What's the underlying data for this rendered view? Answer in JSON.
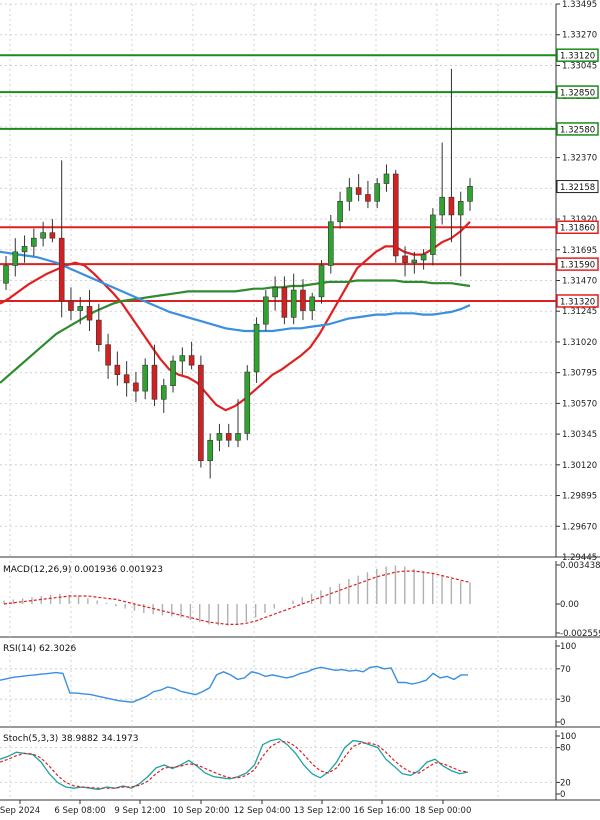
{
  "chart_data": [
    {
      "panel": "price",
      "type": "candlestick",
      "y_ticks": [
        "1.33495",
        "1.33270",
        "1.33045",
        "1.32820",
        "1.32595",
        "1.32370",
        "1.32145",
        "1.31920",
        "1.31695",
        "1.31470",
        "1.31245",
        "1.31020",
        "1.30795",
        "1.30570",
        "1.30345",
        "1.30120",
        "1.29895",
        "1.29670",
        "1.29445"
      ],
      "ylim": [
        1.29445,
        1.33495
      ],
      "current_price": "1.32158",
      "support_resistance": [
        {
          "label": "1.33120",
          "value": 1.3312,
          "color": "#1a8c1a"
        },
        {
          "label": "1.32850",
          "value": 1.3285,
          "color": "#1a8c1a"
        },
        {
          "label": "1.32580",
          "value": 1.3258,
          "color": "#1a8c1a"
        },
        {
          "label": "1.31860",
          "value": 1.3186,
          "color": "#e02020"
        },
        {
          "label": "1.31590",
          "value": 1.3159,
          "color": "#e02020"
        },
        {
          "label": "1.31320",
          "value": 1.3132,
          "color": "#e02020"
        }
      ],
      "candles": [
        [
          1.3145,
          1.3165,
          1.314,
          1.3158
        ],
        [
          1.3158,
          1.3178,
          1.315,
          1.3168
        ],
        [
          1.3168,
          1.318,
          1.316,
          1.3172
        ],
        [
          1.3172,
          1.3185,
          1.3165,
          1.3178
        ],
        [
          1.3178,
          1.319,
          1.3172,
          1.3182
        ],
        [
          1.3182,
          1.3192,
          1.3175,
          1.3178
        ],
        [
          1.3178,
          1.3235,
          1.312,
          1.3132
        ],
        [
          1.3132,
          1.3142,
          1.3118,
          1.3125
        ],
        [
          1.3125,
          1.3135,
          1.3115,
          1.3128
        ],
        [
          1.3128,
          1.314,
          1.311,
          1.3118
        ],
        [
          1.3118,
          1.313,
          1.3095,
          1.31
        ],
        [
          1.31,
          1.3108,
          1.3075,
          1.3085
        ],
        [
          1.3085,
          1.3095,
          1.307,
          1.3078
        ],
        [
          1.3078,
          1.3088,
          1.3062,
          1.3072
        ],
        [
          1.3072,
          1.308,
          1.3058,
          1.3066
        ],
        [
          1.3066,
          1.309,
          1.306,
          1.3085
        ],
        [
          1.3085,
          1.31,
          1.3055,
          1.306
        ],
        [
          1.306,
          1.3075,
          1.305,
          1.307
        ],
        [
          1.307,
          1.3092,
          1.3065,
          1.3088
        ],
        [
          1.3088,
          1.3098,
          1.3078,
          1.3092
        ],
        [
          1.3092,
          1.3102,
          1.3082,
          1.3085
        ],
        [
          1.3085,
          1.3092,
          1.301,
          1.3015
        ],
        [
          1.3015,
          1.3035,
          1.3002,
          1.303
        ],
        [
          1.303,
          1.3042,
          1.3022,
          1.3035
        ],
        [
          1.3035,
          1.3042,
          1.3025,
          1.303
        ],
        [
          1.303,
          1.306,
          1.3025,
          1.3035
        ],
        [
          1.3035,
          1.3085,
          1.303,
          1.308
        ],
        [
          1.308,
          1.312,
          1.3072,
          1.3115
        ],
        [
          1.3115,
          1.314,
          1.311,
          1.3135
        ],
        [
          1.3135,
          1.315,
          1.3125,
          1.3142
        ],
        [
          1.3142,
          1.315,
          1.3115,
          1.312
        ],
        [
          1.312,
          1.3152,
          1.3115,
          1.314
        ],
        [
          1.314,
          1.3148,
          1.3118,
          1.3125
        ],
        [
          1.3125,
          1.3138,
          1.3118,
          1.3135
        ],
        [
          1.3135,
          1.3162,
          1.313,
          1.3158
        ],
        [
          1.3158,
          1.3195,
          1.3152,
          1.319
        ],
        [
          1.319,
          1.3212,
          1.3185,
          1.3205
        ],
        [
          1.3205,
          1.3222,
          1.3198,
          1.3215
        ],
        [
          1.3215,
          1.3225,
          1.3205,
          1.321
        ],
        [
          1.321,
          1.322,
          1.32,
          1.3205
        ],
        [
          1.3205,
          1.3222,
          1.32,
          1.3218
        ],
        [
          1.3218,
          1.3232,
          1.3212,
          1.3225
        ],
        [
          1.3225,
          1.3228,
          1.316,
          1.3165
        ],
        [
          1.3165,
          1.3172,
          1.315,
          1.316
        ],
        [
          1.316,
          1.3168,
          1.3152,
          1.3162
        ],
        [
          1.3162,
          1.317,
          1.3155,
          1.3166
        ],
        [
          1.3166,
          1.32,
          1.3158,
          1.3195
        ],
        [
          1.3195,
          1.3248,
          1.3188,
          1.3208
        ],
        [
          1.3208,
          1.3302,
          1.3175,
          1.3195
        ],
        [
          1.3195,
          1.3212,
          1.315,
          1.3205
        ],
        [
          1.3205,
          1.3222,
          1.3198,
          1.3216
        ]
      ],
      "moving_averages": [
        {
          "color": "#e02020",
          "values": [
            1.313,
            1.3134,
            1.3139,
            1.3144,
            1.3148,
            1.3152,
            1.3155,
            1.3158,
            1.316,
            1.3158,
            1.3152,
            1.3145,
            1.3138,
            1.313,
            1.312,
            1.311,
            1.31,
            1.309,
            1.3082,
            1.3078,
            1.3076,
            1.3072,
            1.3064,
            1.3056,
            1.3052,
            1.3055,
            1.306,
            1.3066,
            1.3072,
            1.3078,
            1.3082,
            1.3087,
            1.3092,
            1.3098,
            1.3108,
            1.312,
            1.3132,
            1.3144,
            1.3156,
            1.3162,
            1.3168,
            1.3172,
            1.3172,
            1.3168,
            1.3166,
            1.3166,
            1.317,
            1.3175,
            1.3178,
            1.3183,
            1.319
          ]
        },
        {
          "color": "#2e8b2e",
          "values": [
            1.3072,
            1.3078,
            1.3084,
            1.309,
            1.3096,
            1.3102,
            1.3108,
            1.3112,
            1.3116,
            1.312,
            1.3124,
            1.3127,
            1.313,
            1.3132,
            1.3133,
            1.3134,
            1.3135,
            1.3136,
            1.3137,
            1.3138,
            1.3139,
            1.3139,
            1.3139,
            1.3139,
            1.3139,
            1.3139,
            1.314,
            1.3141,
            1.3141,
            1.3142,
            1.3142,
            1.3143,
            1.3143,
            1.3144,
            1.3145,
            1.3146,
            1.3146,
            1.3146,
            1.3147,
            1.3147,
            1.3147,
            1.3147,
            1.3147,
            1.3146,
            1.3146,
            1.3146,
            1.3145,
            1.3145,
            1.3145,
            1.3144,
            1.3143
          ]
        },
        {
          "color": "#3a8fe0",
          "values": [
            1.3168,
            1.3167,
            1.3166,
            1.3165,
            1.3164,
            1.3162,
            1.316,
            1.3157,
            1.3154,
            1.3151,
            1.3148,
            1.3145,
            1.3142,
            1.3139,
            1.3136,
            1.3133,
            1.313,
            1.3127,
            1.3124,
            1.3122,
            1.312,
            1.3118,
            1.3116,
            1.3114,
            1.3112,
            1.3111,
            1.311,
            1.311,
            1.311,
            1.311,
            1.3111,
            1.3112,
            1.3112,
            1.3113,
            1.3114,
            1.3115,
            1.3117,
            1.3119,
            1.312,
            1.3121,
            1.3122,
            1.3122,
            1.3123,
            1.3123,
            1.3123,
            1.3122,
            1.3122,
            1.3123,
            1.3124,
            1.3126,
            1.3129
          ]
        }
      ]
    },
    {
      "panel": "macd",
      "type": "bar",
      "label": "MACD(12,26,9) 0.001936 0.001923",
      "y_ticks": [
        "0.003438",
        "0.00",
        "-0.002559"
      ],
      "ylim": [
        -0.002559,
        0.003438
      ],
      "histogram": [
        0.0003,
        0.0004,
        0.0005,
        0.0006,
        0.0007,
        0.0008,
        0.0009,
        0.0008,
        0.0007,
        0.0005,
        0.0003,
        0.0001,
        -0.0002,
        -0.0004,
        -0.0006,
        -0.0008,
        -0.0009,
        -0.001,
        -0.0011,
        -0.0012,
        -0.0014,
        -0.0016,
        -0.0018,
        -0.0019,
        -0.0019,
        -0.0018,
        -0.0016,
        -0.0012,
        -0.0008,
        -0.0004,
        0.0,
        0.0003,
        0.0006,
        0.0009,
        0.0012,
        0.0015,
        0.0018,
        0.0022,
        0.0025,
        0.0028,
        0.0031,
        0.0033,
        0.0034,
        0.0033,
        0.0031,
        0.0029,
        0.0027,
        0.0025,
        0.0022,
        0.002,
        0.0019
      ],
      "signal": [
        0.0,
        0.0001,
        0.0002,
        0.0003,
        0.0004,
        0.0005,
        0.0006,
        0.0007,
        0.0007,
        0.0007,
        0.0006,
        0.0005,
        0.0004,
        0.0002,
        0.0,
        -0.0002,
        -0.0004,
        -0.0006,
        -0.0008,
        -0.001,
        -0.0012,
        -0.0014,
        -0.0016,
        -0.0017,
        -0.0018,
        -0.0018,
        -0.0017,
        -0.0015,
        -0.0012,
        -0.0009,
        -0.0006,
        -0.0003,
        0.0,
        0.0003,
        0.0006,
        0.0009,
        0.0012,
        0.0015,
        0.0018,
        0.0021,
        0.0024,
        0.0026,
        0.0028,
        0.0029,
        0.0029,
        0.0028,
        0.0027,
        0.0025,
        0.0023,
        0.0021,
        0.0019
      ]
    },
    {
      "panel": "rsi",
      "type": "line",
      "label": "RSI(14) 62.3026",
      "y_ticks": [
        "100",
        "70",
        "30",
        "0"
      ],
      "ylim": [
        0,
        100
      ],
      "values": [
        55,
        57,
        59,
        60,
        61,
        62,
        63,
        64,
        65,
        64,
        38,
        38,
        37,
        36,
        34,
        32,
        30,
        28,
        27,
        26,
        30,
        34,
        40,
        42,
        46,
        44,
        40,
        38,
        36,
        40,
        45,
        62,
        66,
        62,
        56,
        58,
        66,
        64,
        60,
        62,
        60,
        58,
        60,
        64,
        66,
        70,
        72,
        70,
        68,
        69,
        67,
        68,
        66,
        72,
        73,
        70,
        71,
        52,
        52,
        50,
        52,
        55,
        64,
        58,
        60,
        56,
        62,
        62
      ]
    },
    {
      "panel": "stoch",
      "type": "line",
      "label": "Stoch(5,3,3) 38.9882 34.1973",
      "y_ticks": [
        "100",
        "80",
        "20",
        "0"
      ],
      "ylim": [
        0,
        100
      ],
      "k": [
        60,
        65,
        72,
        70,
        68,
        55,
        35,
        20,
        12,
        10,
        12,
        10,
        8,
        12,
        10,
        14,
        10,
        18,
        30,
        45,
        50,
        44,
        50,
        58,
        48,
        36,
        30,
        28,
        26,
        30,
        36,
        50,
        85,
        92,
        95,
        85,
        70,
        50,
        35,
        28,
        38,
        55,
        80,
        92,
        90,
        85,
        80,
        60,
        48,
        35,
        32,
        40,
        55,
        60,
        48,
        40,
        35,
        38
      ],
      "d": [
        55,
        60,
        66,
        70,
        69,
        62,
        48,
        32,
        20,
        14,
        12,
        11,
        10,
        10,
        10,
        12,
        12,
        15,
        22,
        35,
        45,
        46,
        48,
        52,
        50,
        44,
        38,
        32,
        28,
        28,
        32,
        42,
        65,
        82,
        90,
        90,
        82,
        68,
        52,
        40,
        36,
        45,
        64,
        82,
        88,
        88,
        84,
        72,
        58,
        46,
        38,
        36,
        45,
        54,
        52,
        46,
        40,
        38
      ]
    },
    {
      "panel": "x-axis",
      "type": "axis",
      "x_ticks": [
        "Sep 2024",
        "6 Sep 08:00",
        "9 Sep 12:00",
        "10 Sep 20:00",
        "12 Sep 04:00",
        "13 Sep 12:00",
        "16 Sep 16:00",
        "18 Sep 00:00"
      ]
    }
  ]
}
